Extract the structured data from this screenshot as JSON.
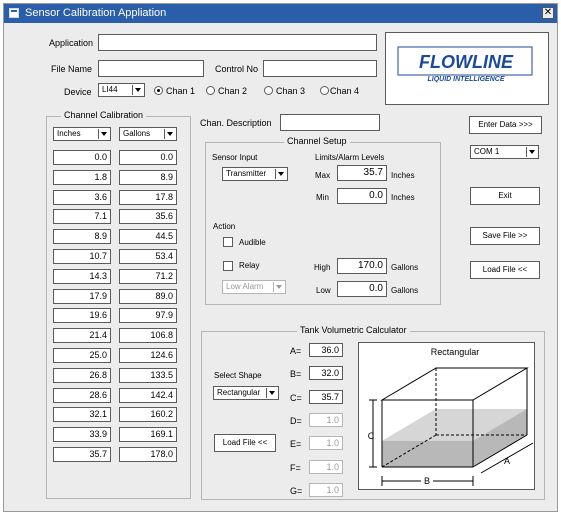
{
  "window": {
    "title": "Sensor Calibration Appliation",
    "close_label": "✕"
  },
  "header": {
    "application_label": "Application",
    "application_value": "",
    "file_name_label": "File Name",
    "file_name_value": "",
    "control_no_label": "Control No",
    "control_no_value": "",
    "device_label": "Device",
    "device_value": "LI44",
    "channels": [
      "Chan 1",
      "Chan 2",
      "Chan 3",
      "Chan 4"
    ],
    "selected_channel": "Chan 1"
  },
  "logo": {
    "top": "FLOWLINE",
    "bottom": "LIQUID INTELLIGENCE"
  },
  "calibration": {
    "title": "Channel Calibration",
    "unit_left": "Inches",
    "unit_right": "Gallons",
    "rows": [
      [
        "0.0",
        "0.0"
      ],
      [
        "1.8",
        "8.9"
      ],
      [
        "3.6",
        "17.8"
      ],
      [
        "7.1",
        "35.6"
      ],
      [
        "8.9",
        "44.5"
      ],
      [
        "10.7",
        "53.4"
      ],
      [
        "14.3",
        "71.2"
      ],
      [
        "17.9",
        "89.0"
      ],
      [
        "19.6",
        "97.9"
      ],
      [
        "21.4",
        "106.8"
      ],
      [
        "25.0",
        "124.6"
      ],
      [
        "26.8",
        "133.5"
      ],
      [
        "28.6",
        "142.4"
      ],
      [
        "32.1",
        "160.2"
      ],
      [
        "33.9",
        "169.1"
      ],
      [
        "35.7",
        "178.0"
      ]
    ]
  },
  "description": {
    "label": "Chan. Description",
    "value": ""
  },
  "setup": {
    "title": "Channel Setup",
    "sensor_input_label": "Sensor Input",
    "sensor_input_value": "Transmitter",
    "limits_label": "Limits/Alarm Levels",
    "max_label": "Max",
    "max_value": "35.7",
    "max_unit": "Inches",
    "min_label": "Min",
    "min_value": "0.0",
    "min_unit": "Inches",
    "action_label": "Action",
    "audible_label": "Audible",
    "relay_label": "Relay",
    "alarm_value": "Low Alarm",
    "high_label": "High",
    "high_value": "170.0",
    "high_unit": "Gallons",
    "low_label": "Low",
    "low_value": "0.0",
    "low_unit": "Gallons"
  },
  "side": {
    "enter_data": "Enter Data >>>",
    "com_port": "COM 1",
    "exit": "Exit",
    "save_file": "Save File >>",
    "load_file": "Load File <<"
  },
  "tank": {
    "title": "Tank Volumetric Calculator",
    "select_shape_label": "Select Shape",
    "shape_value": "Rectangular",
    "load_file": "Load File <<",
    "fields": [
      {
        "label": "A=",
        "value": "36.0",
        "enabled": true
      },
      {
        "label": "B=",
        "value": "32.0",
        "enabled": true
      },
      {
        "label": "C=",
        "value": "35.7",
        "enabled": true
      },
      {
        "label": "D=",
        "value": "1.0",
        "enabled": false
      },
      {
        "label": "E=",
        "value": "1.0",
        "enabled": false
      },
      {
        "label": "F=",
        "value": "1.0",
        "enabled": false
      },
      {
        "label": "G=",
        "value": "1.0",
        "enabled": false
      }
    ],
    "diagram_title": "Rectangular",
    "dim_a": "A",
    "dim_b": "B",
    "dim_c": "C"
  },
  "colors": {
    "titlebar": "#2a5ea8",
    "logo_blue": "#1a4a9c",
    "fluid": "#b8b8b8"
  }
}
